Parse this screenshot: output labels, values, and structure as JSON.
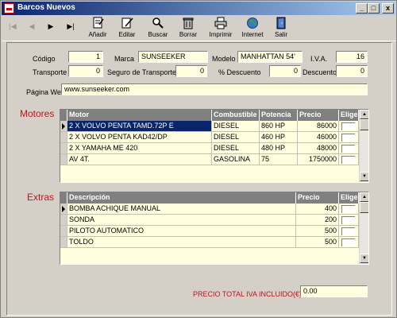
{
  "window": {
    "title": "Barcos Nuevos",
    "controls": {
      "minimize": "_",
      "maximize": "□",
      "close": "x"
    }
  },
  "toolbar": {
    "nav": {
      "first": "|◀",
      "prev": "◀",
      "next": "▶",
      "last": "▶|"
    },
    "buttons": [
      {
        "label": "Añadir",
        "icon": "new-document-icon"
      },
      {
        "label": "Editar",
        "icon": "edit-icon"
      },
      {
        "label": "Buscar",
        "icon": "search-icon"
      },
      {
        "label": "Borrar",
        "icon": "trash-icon"
      },
      {
        "label": "Imprimir",
        "icon": "printer-icon"
      },
      {
        "label": "Internet",
        "icon": "globe-icon"
      },
      {
        "label": "Salir",
        "icon": "exit-door-icon"
      }
    ]
  },
  "form": {
    "codigo": {
      "label": "Código",
      "value": "1"
    },
    "marca": {
      "label": "Marca",
      "value": "SUNSEEKER"
    },
    "modelo": {
      "label": "Modelo",
      "value": "MANHATTAN 54'"
    },
    "iva": {
      "label": "I.V.A.",
      "value": "16"
    },
    "transporte": {
      "label": "Transporte",
      "value": "0"
    },
    "seguro": {
      "label": "Seguro de Transporte",
      "value": "0"
    },
    "pct_descuento": {
      "label": "% Descuento",
      "value": "0"
    },
    "descuento": {
      "label": "Descuento",
      "value": "0"
    },
    "pagina_web": {
      "label": "Página Web",
      "value": "www.sunseeker.com"
    }
  },
  "motores": {
    "title": "Motores",
    "columns": [
      "Motor",
      "Combustible",
      "Potencia",
      "Precio",
      "Elige"
    ],
    "rows": [
      {
        "motor": "2 X VOLVO PENTA TAMD.72P E",
        "combustible": "DIESEL",
        "potencia": "860 HP",
        "precio": "86000"
      },
      {
        "motor": "2 X VOLVO PENTA KAD42/DP",
        "combustible": "DIESEL",
        "potencia": "460 HP",
        "precio": "46000"
      },
      {
        "motor": "2 X YAMAHA ME 420",
        "combustible": "DIESEL",
        "potencia": "480 HP",
        "precio": "48000"
      },
      {
        "motor": "AV 4T.",
        "combustible": "GASOLINA",
        "potencia": "75",
        "precio": "1750000"
      }
    ]
  },
  "extras": {
    "title": "Extras",
    "columns": [
      "Descripción",
      "Precio",
      "Elige"
    ],
    "rows": [
      {
        "descripcion": "BOMBA ACHIQUE MANUAL",
        "precio": "400"
      },
      {
        "descripcion": "SONDA",
        "precio": "200"
      },
      {
        "descripcion": "PILOTO AUTOMATICO",
        "precio": "500"
      },
      {
        "descripcion": "TOLDO",
        "precio": "500"
      }
    ]
  },
  "total": {
    "label": "PRECIO TOTAL IVA INCLUIDO(€)",
    "value": "0.00"
  },
  "colors": {
    "section_red": "#c0141a",
    "field_bg": "#ffffe0",
    "title_blue": "#0a246a",
    "grid_header": "#808080"
  }
}
